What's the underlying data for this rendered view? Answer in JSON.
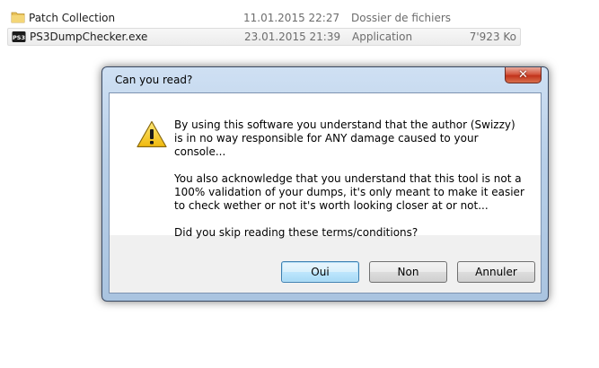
{
  "files": [
    {
      "icon": "folder-icon",
      "name": "Patch Collection",
      "date": "11.01.2015 22:27",
      "type": "Dossier de fichiers",
      "size": ""
    },
    {
      "icon": "ps3-app-icon",
      "name": "PS3DumpChecker.exe",
      "date": "23.01.2015 21:39",
      "type": "Application",
      "size": "7'923 Ko"
    }
  ],
  "dialog": {
    "title": "Can you read?",
    "close_label": "✕",
    "paragraphs": [
      "By using this software you understand that the author (Swizzy) is in no way responsible for ANY damage caused to your console...",
      "You also acknowledge that you understand that this tool is not a 100% validation of your dumps, it's only meant to make it easier to check wether or not it's worth looking closer at or not...",
      "Did you skip reading these terms/conditions?"
    ],
    "icon": "warning-icon",
    "buttons": {
      "yes": "Oui",
      "no": "Non",
      "cancel": "Annuler"
    }
  },
  "colors": {
    "warning": "#f5c419",
    "close": "#c2331b",
    "accent": "#3c7fb1"
  }
}
